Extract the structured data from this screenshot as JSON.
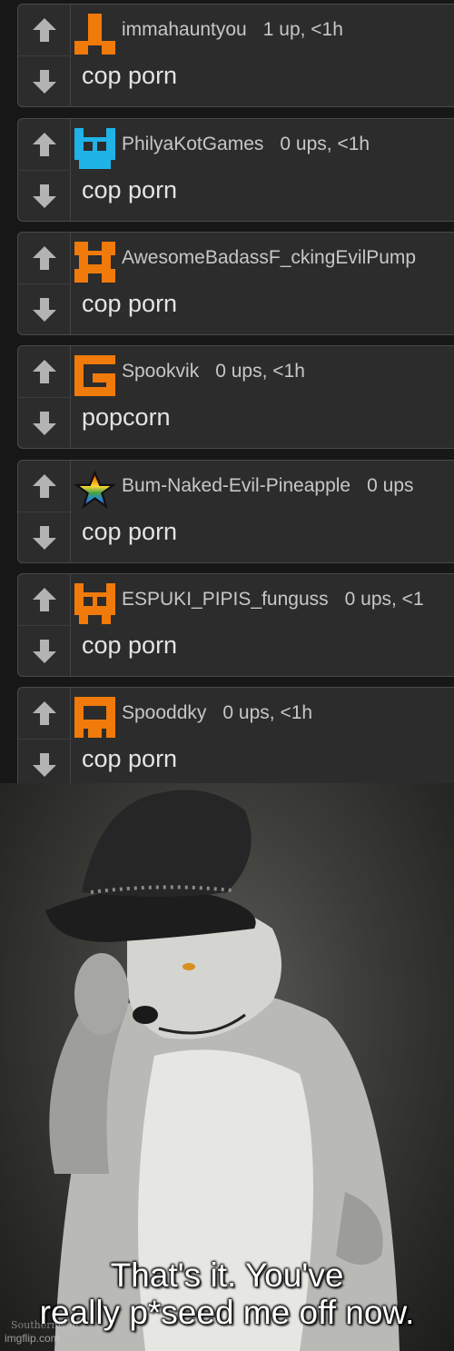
{
  "comments": [
    {
      "username": "immahauntyou",
      "stats": "1 up, <1h",
      "text": "cop porn",
      "avatar_color": "#f07a0a"
    },
    {
      "username": "PhilyaKotGames",
      "stats": "0 ups, <1h",
      "text": "cop porn",
      "avatar_color": "#1fb3e8"
    },
    {
      "username": "AwesomeBadassF_ckingEvilPump",
      "stats": "",
      "text": "cop porn",
      "avatar_color": "#f07a0a"
    },
    {
      "username": "Spookvik",
      "stats": "0 ups, <1h",
      "text": "popcorn",
      "avatar_color": "#f07a0a"
    },
    {
      "username": "Bum-Naked-Evil-Pineapple",
      "stats": "0 ups",
      "text": "cop porn",
      "avatar_color": "rainbow-star"
    },
    {
      "username": "ESPUKI_PIPIS_funguss",
      "stats": "0 ups, <1",
      "text": "cop porn",
      "avatar_color": "#f07a0a"
    },
    {
      "username": "Spooddky",
      "stats": "0 ups, <1h",
      "text": "cop porn",
      "avatar_color": "#f07a0a"
    }
  ],
  "icons": {
    "upvote": "arrow-up-icon",
    "downvote": "arrow-down-icon"
  },
  "meme": {
    "caption_line1": "That's it. You've",
    "caption_line2": "really p*seed me off now.",
    "watermark": "imgflip.com",
    "artist_signature": "Southernwolf"
  },
  "colors": {
    "panel": "#2c2c2c",
    "border": "#4a4a4a",
    "accent": "#f07a0a"
  }
}
